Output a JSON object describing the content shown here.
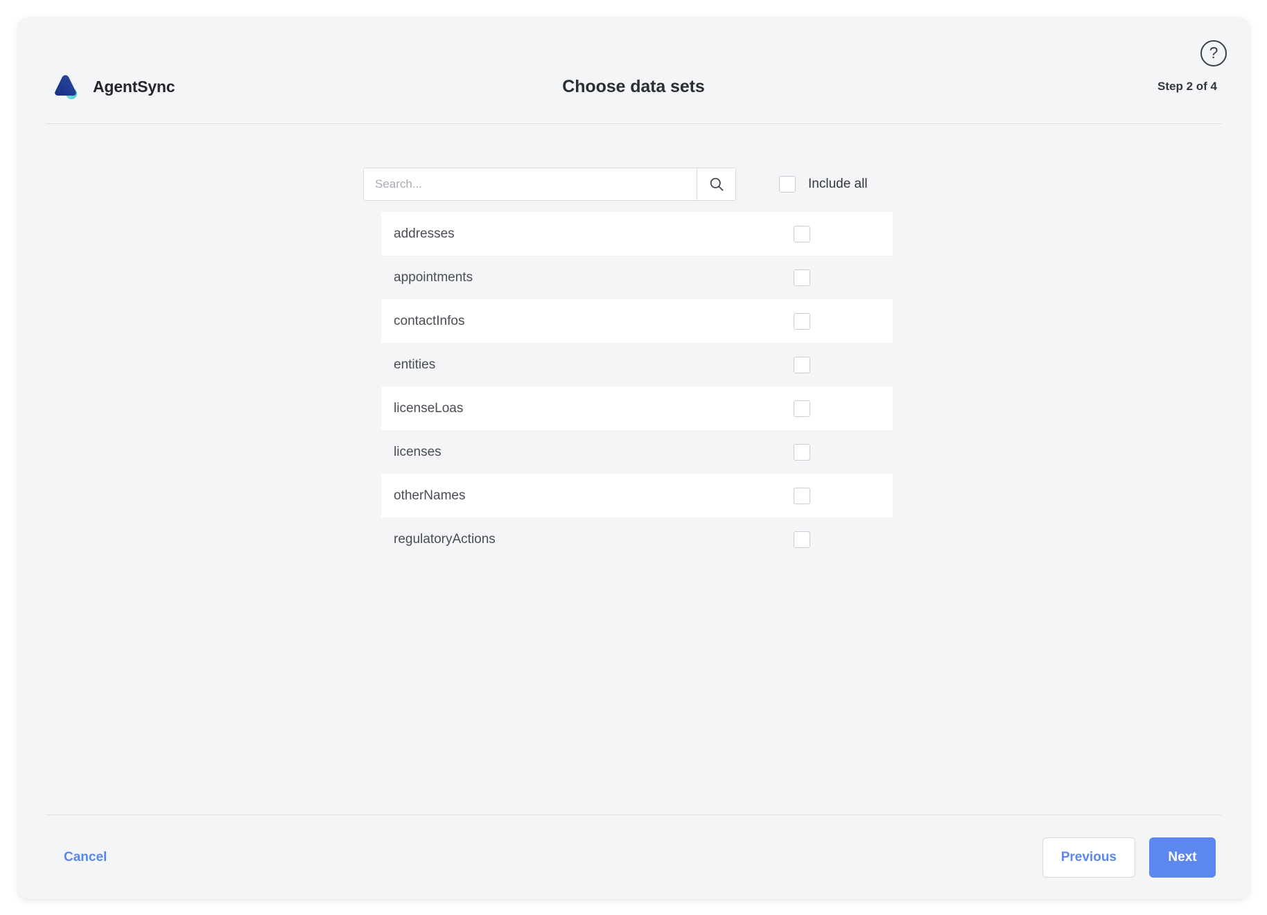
{
  "brand": {
    "name": "AgentSync",
    "logo_icon": "agentsync-logo-icon",
    "logo_color_dark": "#1f3a93",
    "logo_color_accent": "#62d4d9"
  },
  "header": {
    "title": "Choose data sets",
    "step_label": "Step 2 of 4",
    "help_icon": "question-mark-circle-icon",
    "help_glyph": "?"
  },
  "search": {
    "value": "",
    "placeholder": "Search...",
    "icon": "search-icon"
  },
  "include_all": {
    "label": "Include all",
    "checked": false
  },
  "datasets": [
    {
      "name": "addresses",
      "checked": false
    },
    {
      "name": "appointments",
      "checked": false
    },
    {
      "name": "contactInfos",
      "checked": false
    },
    {
      "name": "entities",
      "checked": false
    },
    {
      "name": "licenseLoas",
      "checked": false
    },
    {
      "name": "licenses",
      "checked": false
    },
    {
      "name": "otherNames",
      "checked": false
    },
    {
      "name": "regulatoryActions",
      "checked": false
    }
  ],
  "footer": {
    "cancel_label": "Cancel",
    "previous_label": "Previous",
    "next_label": "Next"
  },
  "colors": {
    "accent_blue": "#5b87ee",
    "card_background": "#f4f5f7",
    "row_background": "#ffffff",
    "text_primary": "#33363d",
    "text_secondary": "#4a4d55"
  }
}
